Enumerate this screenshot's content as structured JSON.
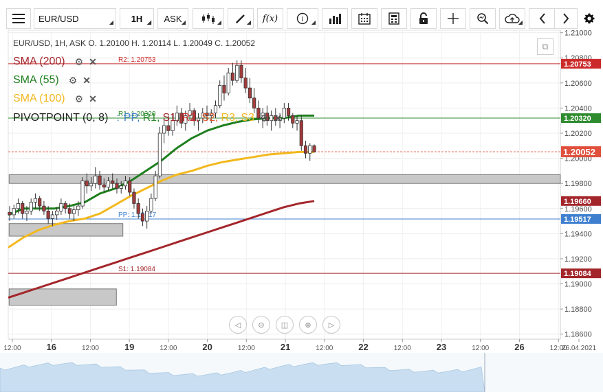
{
  "toolbar": {
    "symbol": "EUR/USD",
    "timeframe": "1H",
    "price_type": "ASK",
    "icons": [
      "menu-icon",
      "candles-icon",
      "draw-icon",
      "function-icon",
      "info-icon",
      "bars-icon",
      "calendar-icon",
      "calculator-icon",
      "lock-icon",
      "crosshair-icon",
      "zoom-icon",
      "cloud-upload-icon",
      "prev-icon",
      "next-icon",
      "gear-icon"
    ],
    "function_label": "f(x)"
  },
  "legend": {
    "ohlc": "EUR/USD, 1H, ASK    O. 1.20100 H. 1.20114 L. 1.20049 C. 1.20052",
    "sma200": "SMA (200)",
    "sma55": "SMA (55)",
    "sma100": "SMA (100)",
    "pivot": "PIVOTPOINT (0, 8)",
    "pivot_sep": ":",
    "pivot_parts": [
      "PP,",
      "R1,",
      "S1,",
      "R2,",
      "S2,",
      "R3,",
      "S3"
    ]
  },
  "colors": {
    "sma200": "#a3262b",
    "sma55": "#1e7f1e",
    "sma100": "#f2b81e",
    "candle": "#a33b3b",
    "r2": "#cc2b2b",
    "r1": "#2e8b2e",
    "pp": "#3f7fcf",
    "s1": "#a3262b",
    "last": "#e0503c",
    "grey_zone": "#c8c8c8",
    "pp_label": "#3f7fcf",
    "r1_label": "#2e8b2e",
    "s1_label": "#a3262b",
    "r2_label": "#cc2b2b",
    "s2_label": "#e8562a",
    "r3_label": "#f2b81e",
    "s3_label": "#f2b81e"
  },
  "chart_data": {
    "type": "candlestick",
    "instrument": "EUR/USD",
    "interval": "1H",
    "price": "ASK",
    "y_ticks": [
      "1.21000",
      "1.20800",
      "1.20600",
      "1.20400",
      "1.20200",
      "1.20000",
      "1.19800",
      "1.19600",
      "1.19400",
      "1.19200",
      "1.19000",
      "1.18800",
      "1.18600"
    ],
    "ylim": [
      1.1856,
      1.2102
    ],
    "x_ticks": [
      {
        "label": "12:00",
        "t": 0
      },
      {
        "label": "16",
        "t": 12
      },
      {
        "label": "12:00",
        "t": 24
      },
      {
        "label": "19",
        "t": 36
      },
      {
        "label": "12:00",
        "t": 48
      },
      {
        "label": "20",
        "t": 60
      },
      {
        "label": "12:00",
        "t": 72
      },
      {
        "label": "21",
        "t": 84
      },
      {
        "label": "12:00",
        "t": 96
      },
      {
        "label": "22",
        "t": 108
      },
      {
        "label": "12:00",
        "t": 120
      },
      {
        "label": "23",
        "t": 132
      },
      {
        "label": "12:00",
        "t": 144
      },
      {
        "label": "26",
        "t": 156
      },
      {
        "label": "12:00",
        "t": 168
      },
      {
        "label": "26.04.2021",
        "t": 180
      }
    ],
    "levels": [
      {
        "name": "R2",
        "label": "R2: 1.20753",
        "badge": "1.20753",
        "value": 1.20753
      },
      {
        "name": "R1",
        "label": "R1: 1.20320",
        "badge": "1.20320",
        "value": 1.2032
      },
      {
        "name": "PP",
        "label": "PP: 1.19517",
        "badge": "1.19517",
        "value": 1.19517
      },
      {
        "name": "S1",
        "label": "S1: 1.19084",
        "badge": "1.19084",
        "value": 1.19084
      }
    ],
    "sma200_badge": "1.19660",
    "sma200_last": 1.1966,
    "last_price": {
      "label": "1.20052",
      "value": 1.20052
    },
    "candles": [
      [
        1.1957,
        1.1962,
        1.195,
        1.1955
      ],
      [
        1.1955,
        1.1963,
        1.1952,
        1.196
      ],
      [
        1.196,
        1.1968,
        1.1956,
        1.1964
      ],
      [
        1.1964,
        1.1966,
        1.1952,
        1.1956
      ],
      [
        1.1956,
        1.1962,
        1.195,
        1.1958
      ],
      [
        1.1958,
        1.1968,
        1.1955,
        1.1965
      ],
      [
        1.1965,
        1.1972,
        1.196,
        1.1968
      ],
      [
        1.1968,
        1.197,
        1.1958,
        1.1962
      ],
      [
        1.1962,
        1.1966,
        1.1955,
        1.1958
      ],
      [
        1.1958,
        1.1962,
        1.1948,
        1.1952
      ],
      [
        1.1952,
        1.1958,
        1.1946,
        1.1955
      ],
      [
        1.1955,
        1.1961,
        1.1951,
        1.1958
      ],
      [
        1.1958,
        1.1968,
        1.1955,
        1.1964
      ],
      [
        1.1964,
        1.1966,
        1.1956,
        1.196
      ],
      [
        1.196,
        1.1964,
        1.1952,
        1.1956
      ],
      [
        1.1956,
        1.1962,
        1.195,
        1.1959
      ],
      [
        1.1959,
        1.1966,
        1.1954,
        1.1962
      ],
      [
        1.1962,
        1.1985,
        1.196,
        1.1982
      ],
      [
        1.1982,
        1.1988,
        1.1972,
        1.1978
      ],
      [
        1.1978,
        1.1985,
        1.1974,
        1.198
      ],
      [
        1.198,
        1.1993,
        1.1976,
        1.1986
      ],
      [
        1.1986,
        1.199,
        1.1975,
        1.1979
      ],
      [
        1.1979,
        1.1984,
        1.1973,
        1.1977
      ],
      [
        1.1977,
        1.1985,
        1.1974,
        1.1982
      ],
      [
        1.1982,
        1.1988,
        1.1976,
        1.198
      ],
      [
        1.198,
        1.1984,
        1.1972,
        1.1976
      ],
      [
        1.1976,
        1.1982,
        1.1972,
        1.1978
      ],
      [
        1.1978,
        1.1986,
        1.1975,
        1.1982
      ],
      [
        1.1982,
        1.1985,
        1.197,
        1.1973
      ],
      [
        1.1973,
        1.1976,
        1.196,
        1.1964
      ],
      [
        1.1964,
        1.1968,
        1.1952,
        1.1956
      ],
      [
        1.1956,
        1.196,
        1.1946,
        1.195
      ],
      [
        1.195,
        1.1962,
        1.1944,
        1.1958
      ],
      [
        1.1958,
        1.1972,
        1.1956,
        1.1968
      ],
      [
        1.1968,
        1.199,
        1.1966,
        1.1986
      ],
      [
        1.1986,
        1.2025,
        1.1984,
        1.202
      ],
      [
        1.202,
        1.2032,
        1.2012,
        1.2026
      ],
      [
        1.2026,
        1.2034,
        1.2018,
        1.2022
      ],
      [
        1.2022,
        1.2036,
        1.2018,
        1.203
      ],
      [
        1.203,
        1.2042,
        1.2026,
        1.2036
      ],
      [
        1.2036,
        1.204,
        1.2024,
        1.2028
      ],
      [
        1.2028,
        1.2038,
        1.2022,
        1.2034
      ],
      [
        1.2034,
        1.2044,
        1.203,
        1.2038
      ],
      [
        1.2038,
        1.204,
        1.2026,
        1.203
      ],
      [
        1.203,
        1.2036,
        1.2022,
        1.2032
      ],
      [
        1.2032,
        1.204,
        1.2028,
        1.2036
      ],
      [
        1.2036,
        1.2042,
        1.203,
        1.2034
      ],
      [
        1.2034,
        1.2039,
        1.2028,
        1.2036
      ],
      [
        1.2036,
        1.2046,
        1.2032,
        1.2042
      ],
      [
        1.2042,
        1.2062,
        1.204,
        1.2058
      ],
      [
        1.2058,
        1.2066,
        1.2046,
        1.2052
      ],
      [
        1.2052,
        1.2072,
        1.205,
        1.2068
      ],
      [
        1.2068,
        1.2076,
        1.2058,
        1.2062
      ],
      [
        1.2062,
        1.2078,
        1.206,
        1.2074
      ],
      [
        1.2074,
        1.2078,
        1.206,
        1.2064
      ],
      [
        1.2064,
        1.2072,
        1.2052,
        1.2056
      ],
      [
        1.2056,
        1.2064,
        1.2044,
        1.2048
      ],
      [
        1.2048,
        1.2056,
        1.2036,
        1.204
      ],
      [
        1.204,
        1.2046,
        1.2028,
        1.2032
      ],
      [
        1.2032,
        1.204,
        1.2024,
        1.2036
      ],
      [
        1.2036,
        1.2042,
        1.2026,
        1.203
      ],
      [
        1.203,
        1.2038,
        1.2022,
        1.2034
      ],
      [
        1.2034,
        1.204,
        1.2026,
        1.203
      ],
      [
        1.203,
        1.2036,
        1.2024,
        1.2032
      ],
      [
        1.2032,
        1.2044,
        1.2028,
        1.204
      ],
      [
        1.204,
        1.2044,
        1.203,
        1.2034
      ],
      [
        1.2034,
        1.2036,
        1.2024,
        1.2028
      ],
      [
        1.2028,
        1.2034,
        1.2022,
        1.203
      ],
      [
        1.203,
        1.2034,
        1.2006,
        1.201
      ],
      [
        1.201,
        1.2014,
        1.2,
        1.2004
      ],
      [
        1.2004,
        1.2012,
        1.1998,
        1.201
      ],
      [
        1.201,
        1.2011,
        1.2005,
        1.2005
      ]
    ],
    "sma200": [
      1.1889,
      1.1893,
      1.1897,
      1.1901,
      1.1905,
      1.1909,
      1.1913,
      1.1917,
      1.1921,
      1.1925,
      1.1929,
      1.1933,
      1.1937,
      1.1941,
      1.1945,
      1.1949,
      1.1953,
      1.1957,
      1.1961,
      1.1964,
      1.1966
    ],
    "sma55": [
      1.1955,
      1.196,
      1.196,
      1.196,
      1.1962,
      1.1965,
      1.1972,
      1.1976,
      1.1982,
      1.199,
      1.1998,
      1.2008,
      1.2016,
      1.2022,
      1.2026,
      1.2029,
      1.2031,
      1.2032,
      1.2032,
      1.2034,
      1.2034
    ],
    "sma100": [
      1.1929,
      1.1937,
      1.1943,
      1.1947,
      1.195,
      1.1952,
      1.1956,
      1.1963,
      1.197,
      1.1976,
      1.1982,
      1.1987,
      1.199,
      1.1994,
      1.1997,
      1.1999,
      1.2001,
      1.2003,
      1.2004,
      1.2005,
      1.2005
    ],
    "zones": [
      {
        "from_t": -1,
        "to_t": 170,
        "lo": 1.198,
        "hi": 1.1987
      },
      {
        "from_t": -1,
        "to_t": 34,
        "lo": 1.1938,
        "hi": 1.1948
      },
      {
        "from_t": -1,
        "to_t": 32,
        "lo": 1.1883,
        "hi": 1.1896
      }
    ]
  }
}
